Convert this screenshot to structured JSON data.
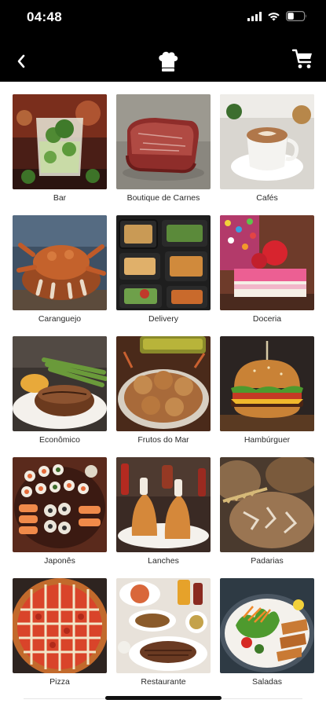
{
  "status_bar": {
    "time": "04:48"
  },
  "nav": {
    "back_icon": "chevron-left-icon",
    "center_icon": "chef-hat-icon",
    "cart_icon": "shopping-cart-icon"
  },
  "categories": [
    {
      "label": "Bar"
    },
    {
      "label": "Boutique de Carnes"
    },
    {
      "label": "Cafés"
    },
    {
      "label": "Caranguejo"
    },
    {
      "label": "Delivery"
    },
    {
      "label": "Doceria"
    },
    {
      "label": "Econômico"
    },
    {
      "label": "Frutos do Mar"
    },
    {
      "label": "Hambúrguer"
    },
    {
      "label": "Japonês"
    },
    {
      "label": "Lanches"
    },
    {
      "label": "Padarias"
    },
    {
      "label": "Pizza"
    },
    {
      "label": "Restaurante"
    },
    {
      "label": "Saladas"
    }
  ],
  "colors": {
    "header": "#000000",
    "background": "#ffffff",
    "label_text": "#2a2a2a"
  }
}
